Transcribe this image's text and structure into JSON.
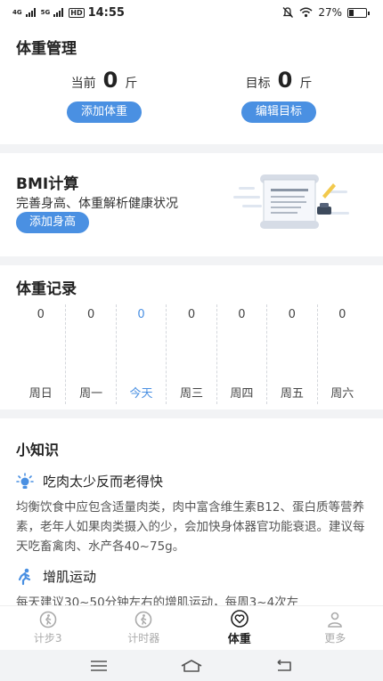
{
  "status_bar": {
    "network1": "4G",
    "network2": "5G",
    "hd": "HD",
    "time": "14:55",
    "battery_text": "27%",
    "battery_level": 0.27
  },
  "weight_management": {
    "title": "体重管理",
    "current_label": "当前",
    "current_value": "0",
    "target_label": "目标",
    "target_value": "0",
    "unit": "斤",
    "add_weight_button": "添加体重",
    "edit_target_button": "编辑目标"
  },
  "bmi": {
    "title": "BMI计算",
    "subtitle": "完善身高、体重解析健康状况",
    "add_height_button": "添加身高"
  },
  "records": {
    "title": "体重记录",
    "days": [
      {
        "label": "周日",
        "value": "0"
      },
      {
        "label": "周一",
        "value": "0"
      },
      {
        "label": "今天",
        "value": "0"
      },
      {
        "label": "周三",
        "value": "0"
      },
      {
        "label": "周四",
        "value": "0"
      },
      {
        "label": "周五",
        "value": "0"
      },
      {
        "label": "周六",
        "value": "0"
      }
    ]
  },
  "tips": {
    "title": "小知识",
    "items": [
      {
        "icon": "lightbulb-icon",
        "title": "吃肉太少反而老得快",
        "body": "均衡饮食中应包含适量肉类，肉中富含维生素B12、蛋白质等营养素，老年人如果肉类摄入的少，会加快身体器官功能衰退。建议每天吃畜禽肉、水产各40~75g。"
      },
      {
        "icon": "running-icon",
        "title": "增肌运动",
        "body": "每天建议30~50分钟左右的增肌运动，每周3~4次左"
      }
    ]
  },
  "tabbar": {
    "tabs": [
      {
        "label": "计步3",
        "icon": "step-icon"
      },
      {
        "label": "计时器",
        "icon": "step-icon"
      },
      {
        "label": "体重",
        "icon": "heart-icon"
      },
      {
        "label": "更多",
        "icon": "person-icon"
      }
    ]
  },
  "colors": {
    "accent": "#4a90e2",
    "background": "#f2f3f5",
    "card": "#ffffff"
  }
}
